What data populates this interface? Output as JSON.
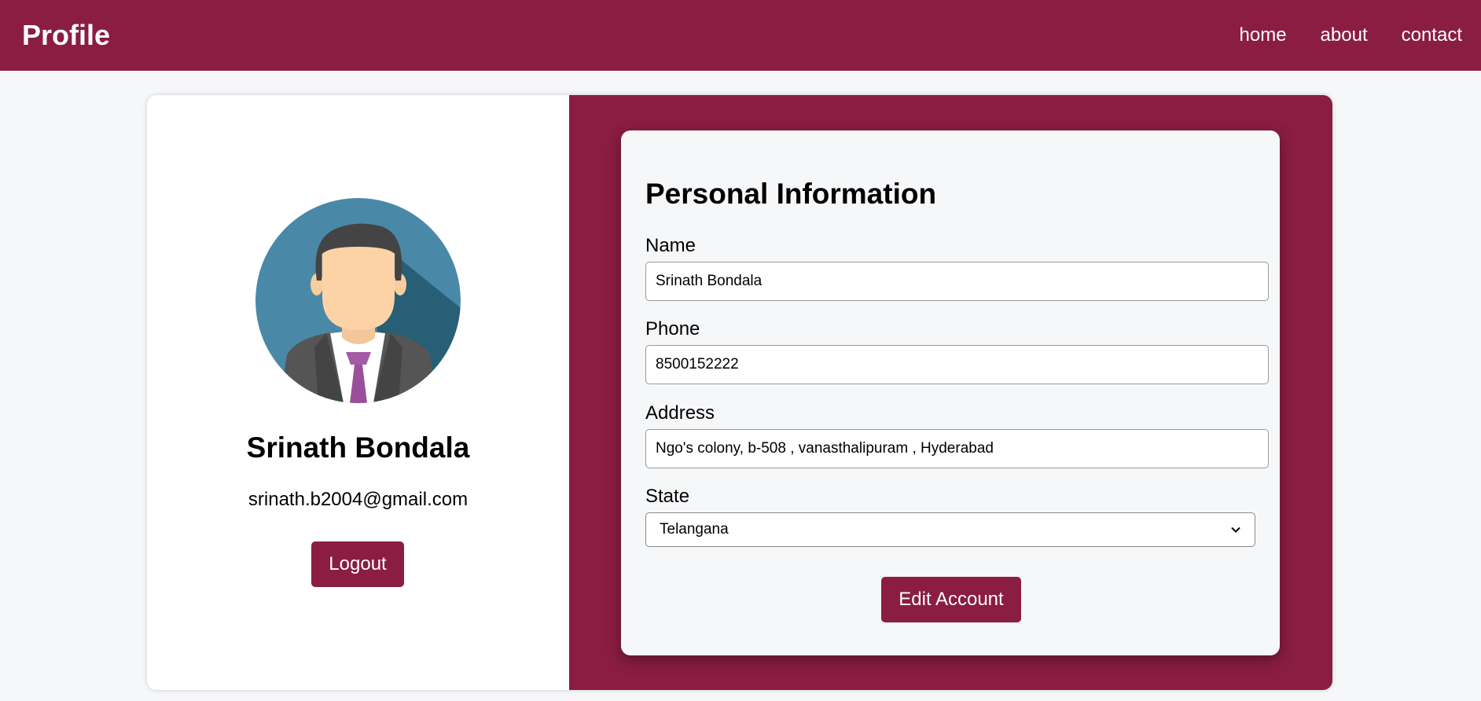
{
  "navbar": {
    "brand": "Profile",
    "links": [
      "home",
      "about",
      "contact"
    ]
  },
  "profile": {
    "name": "Srinath Bondala",
    "email": "srinath.b2004@gmail.com",
    "logout_label": "Logout"
  },
  "form": {
    "heading": "Personal Information",
    "name_label": "Name",
    "name_value": "Srinath Bondala",
    "phone_label": "Phone",
    "phone_value": "8500152222",
    "address_label": "Address",
    "address_value": "Ngo's colony, b-508 , vanasthalipuram , Hyderabad",
    "state_label": "State",
    "state_value": "Telangana",
    "edit_label": "Edit Account"
  },
  "colors": {
    "brand": "#8a1d41",
    "background": "#f6f7f9",
    "tie": "#9b4f9b",
    "avatar_bg": "#4a88a8"
  },
  "icons": {
    "avatar": "businessman-avatar-icon",
    "select": "chevron-down-icon"
  }
}
